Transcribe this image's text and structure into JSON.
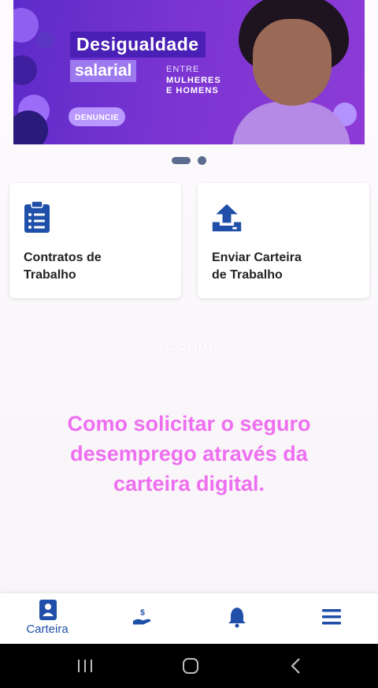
{
  "banner": {
    "title_line1": "Desigualdade",
    "title_line2": "salarial",
    "entre": "ENTRE",
    "mulheres": "MULHERES",
    "homens": "E HOMENS",
    "pill": "DENUNCIE"
  },
  "carousel": {
    "pages": 2,
    "active_index": 0
  },
  "cards": [
    {
      "label_line1": "Contratos de",
      "label_line2": "Trabalho",
      "icon": "clipboard-list-icon"
    },
    {
      "label_line1": "Enviar Carteira",
      "label_line2": "de Trabalho",
      "icon": "upload-icon"
    }
  ],
  "overlay": {
    "watermark": "eCom",
    "caption": "Como solicitar o seguro desemprego através da carteira digital."
  },
  "bottom_nav": [
    {
      "label": "Carteira",
      "icon": "wallet-card-icon",
      "active": true
    },
    {
      "label": "",
      "icon": "hand-money-icon",
      "active": false
    },
    {
      "label": "",
      "icon": "bell-icon",
      "active": false
    },
    {
      "label": "",
      "icon": "menu-icon",
      "active": false
    }
  ],
  "colors": {
    "primary": "#1f4fa8",
    "banner": "#7a34d2",
    "caption": "#ee6ff0"
  }
}
